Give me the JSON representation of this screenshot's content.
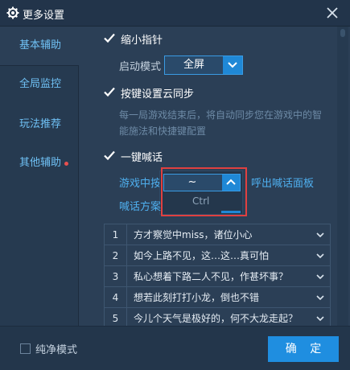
{
  "window": {
    "title": "更多设置",
    "icons": {
      "title": "gear-icon",
      "close": "close-icon"
    }
  },
  "sidebar": {
    "items": [
      {
        "label": "基本辅助"
      },
      {
        "label": "全局监控"
      },
      {
        "label": "玩法推荐"
      },
      {
        "label": "其他辅助"
      }
    ],
    "active_index": 0,
    "badge_color": "#e8504f"
  },
  "main": {
    "zoom_pointer": {
      "label": "缩小指针",
      "checked": true
    },
    "start_mode": {
      "label": "启动模式",
      "value": "全屏"
    },
    "key_cloud_sync": {
      "label": "按键设置云同步",
      "checked": true,
      "description": "每一局游戏结束后，将自动同步您在游戏中的智能施法和快捷键配置"
    },
    "shout": {
      "label": "一键喊话",
      "checked": true,
      "hotkey_label": "游戏中按",
      "hotkey_value": "~",
      "hotkey_option": "Ctrl",
      "call_panel_link": "呼出喊话面板",
      "scheme_label": "喊话方案"
    },
    "phrases": [
      {
        "num": "1",
        "text": "方才察觉中miss，诸位小心"
      },
      {
        "num": "2",
        "text": "如今上路不见，这…这…真可怕"
      },
      {
        "num": "3",
        "text": "私心想着下路二人不见，作甚坏事？"
      },
      {
        "num": "4",
        "text": "想若此刻打打小龙，倒也不错"
      },
      {
        "num": "5",
        "text": "今儿个天气是极好的，何不大龙走起？"
      }
    ]
  },
  "footer": {
    "pure_mode": {
      "label": "纯净模式",
      "checked": false
    },
    "confirm_label": "确 定"
  },
  "colors": {
    "background": "#2b3f56",
    "accent": "#1f8ee0",
    "link": "#4fb0f0",
    "highlight_box": "#e04040"
  }
}
